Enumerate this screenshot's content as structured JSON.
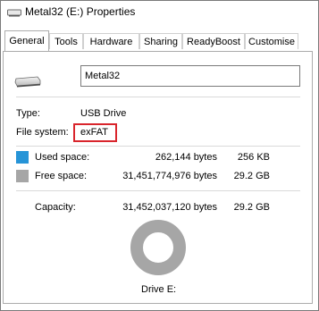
{
  "window": {
    "title": "Metal32 (E:) Properties"
  },
  "tabs": [
    {
      "label": "General"
    },
    {
      "label": "Tools"
    },
    {
      "label": "Hardware"
    },
    {
      "label": "Sharing"
    },
    {
      "label": "ReadyBoost"
    },
    {
      "label": "Customise"
    }
  ],
  "general": {
    "volume_name": "Metal32",
    "type_label": "Type:",
    "type_value": "USB Drive",
    "fs_label": "File system:",
    "fs_value": "exFAT",
    "used_label": "Used space:",
    "used_bytes": "262,144 bytes",
    "used_size": "256 KB",
    "free_label": "Free space:",
    "free_bytes": "31,451,774,976 bytes",
    "free_size": "29.2 GB",
    "capacity_label": "Capacity:",
    "capacity_bytes": "31,452,037,120 bytes",
    "capacity_size": "29.2 GB",
    "drive_label": "Drive E:"
  },
  "colors": {
    "used": "#2694d7",
    "free": "#a6a6a6",
    "highlight": "#d9252c"
  },
  "icons": {
    "title": "usb-drive-icon",
    "drive": "usb-drive-icon"
  }
}
